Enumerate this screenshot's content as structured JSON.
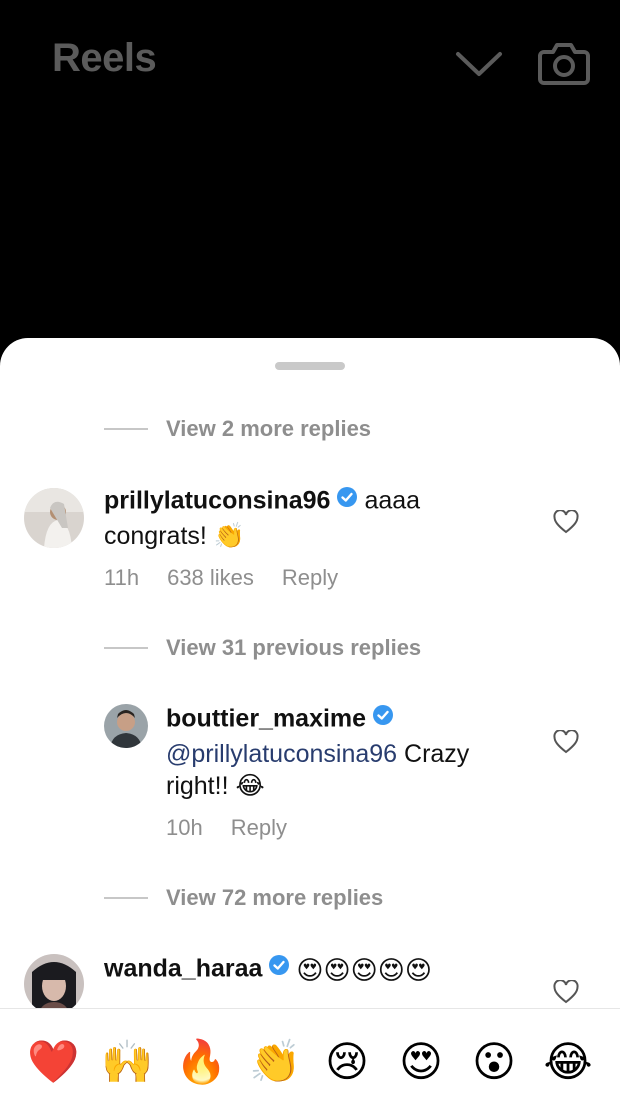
{
  "header": {
    "title": "Reels",
    "dropdown_icon": "chevron-down-icon",
    "camera_icon": "camera-icon"
  },
  "thread": {
    "view_more_1": "View 2 more replies",
    "comment_1": {
      "username": "prillylatuconsina96",
      "text": "aaaa congrats! 👏",
      "time": "11h",
      "likes": "638 likes",
      "reply": "Reply"
    },
    "view_previous": "View 31 previous replies",
    "reply_1": {
      "username": "bouttier_maxime",
      "mention": "@prillylatuconsina96",
      "text": "Crazy right!! 😂",
      "time": "10h",
      "reply": "Reply"
    },
    "view_more_2": "View 72 more replies",
    "comment_2": {
      "username": "wanda_haraa",
      "text": "😍😍😍😍😍"
    }
  },
  "emoji_bar": [
    "❤️",
    "🙌",
    "🔥",
    "👏",
    "😢",
    "😍",
    "😮",
    "😂"
  ],
  "colors": {
    "verified": "#3797f0",
    "mention": "#283c6e",
    "secondary_text": "#8e8e8e"
  }
}
